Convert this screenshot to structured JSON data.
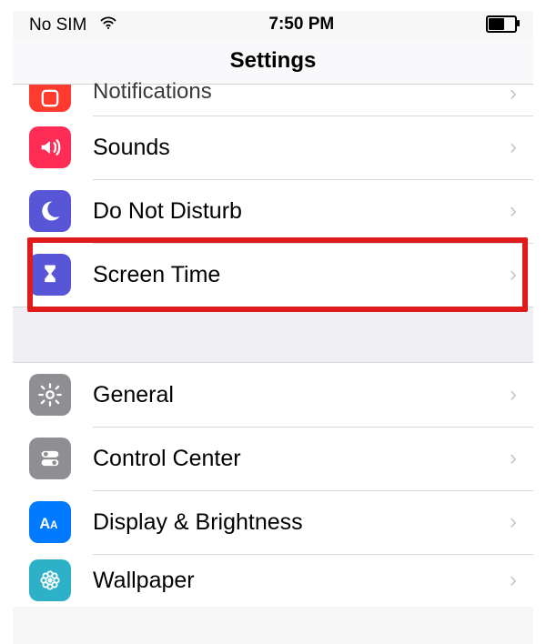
{
  "status": {
    "carrier": "No SIM",
    "time": "7:50 PM"
  },
  "navbar": {
    "title": "Settings"
  },
  "rows": {
    "notifications": {
      "label": "Notifications"
    },
    "sounds": {
      "label": "Sounds"
    },
    "dnd": {
      "label": "Do Not Disturb"
    },
    "screentime": {
      "label": "Screen Time"
    },
    "general": {
      "label": "General"
    },
    "controlcenter": {
      "label": "Control Center"
    },
    "display": {
      "label": "Display & Brightness"
    },
    "wallpaper": {
      "label": "Wallpaper"
    }
  }
}
